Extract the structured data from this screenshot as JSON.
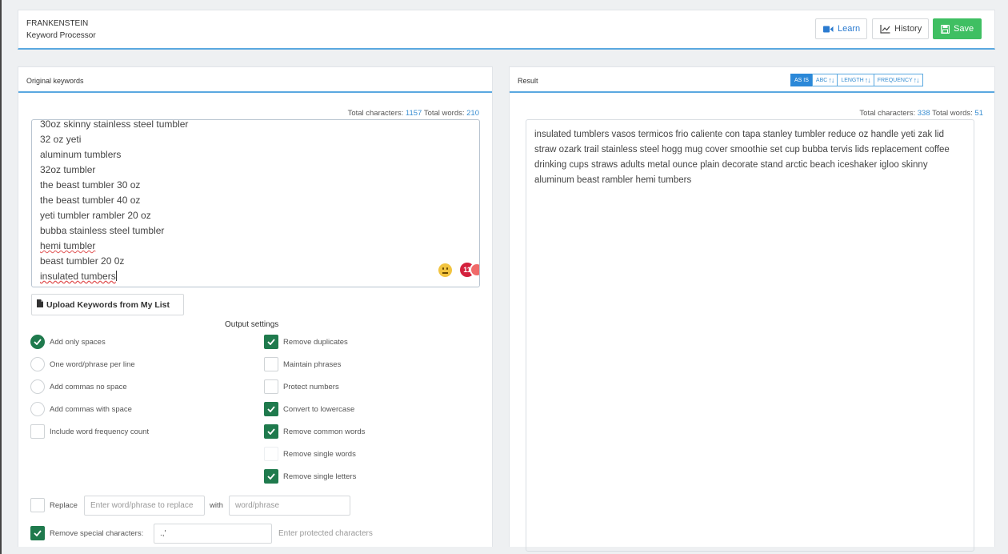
{
  "app": {
    "title": "FRANKENSTEIN",
    "subtitle": "Keyword Processor"
  },
  "toolbar": {
    "learn_label": "Learn",
    "history_label": "History",
    "save_label": "Save"
  },
  "left_panel": {
    "title": "Original keywords",
    "stats": {
      "chars_label": "Total characters:",
      "chars": "1157",
      "words_label": "Total words:",
      "words": "210"
    },
    "keywords": [
      "30oz skinny stainless steel tumbler",
      "32 oz yeti",
      "aluminum tumblers",
      "32oz tumbler",
      "the beast tumbler 30 oz",
      "the beast tumbler 40 oz",
      "yeti tumbler rambler 20 oz",
      "bubba stainless steel tumbler",
      "hemi tumbler",
      "beast tumbler 20 0z",
      "insulated tumbers"
    ],
    "grammar_count": "11",
    "upload_label": "Upload Keywords from My List",
    "output_settings_title": "Output settings",
    "radios": [
      {
        "label": "Add only spaces",
        "checked": true
      },
      {
        "label": "One word/phrase per line",
        "checked": false
      },
      {
        "label": "Add commas no space",
        "checked": false
      },
      {
        "label": "Add commas with space",
        "checked": false
      }
    ],
    "include_freq": {
      "label": "Include word frequency count",
      "checked": false
    },
    "checks": [
      {
        "label": "Remove duplicates",
        "checked": true
      },
      {
        "label": "Maintain phrases",
        "checked": false
      },
      {
        "label": "Protect numbers",
        "checked": false
      },
      {
        "label": "Convert to lowercase",
        "checked": true
      },
      {
        "label": "Remove common words",
        "checked": true
      },
      {
        "label": "Remove single words",
        "checked": false
      },
      {
        "label": "Remove single letters",
        "checked": true
      }
    ],
    "replace": {
      "label": "Replace",
      "checked": false,
      "find_placeholder": "Enter word/phrase to replace",
      "with_label": "with",
      "with_placeholder": "word/phrase"
    },
    "special": {
      "label": "Remove special characters:",
      "checked": true,
      "value": ".,'",
      "protected_placeholder": "Enter protected characters"
    }
  },
  "right_panel": {
    "title": "Result",
    "sort_buttons": [
      {
        "label": "AS IS",
        "arrows": "",
        "active": true
      },
      {
        "label": "ABC",
        "arrows": "↑↓",
        "active": false
      },
      {
        "label": "LENGTH",
        "arrows": "↑↓",
        "active": false
      },
      {
        "label": "FREQUENCY",
        "arrows": "↑↓",
        "active": false
      }
    ],
    "stats": {
      "chars_label": "Total characters:",
      "chars": "338",
      "words_label": "Total words:",
      "words": "51"
    },
    "result_text": "insulated tumblers vasos termicos frio caliente con tapa stanley tumbler reduce oz handle yeti zak lid straw ozark trail stainless steel hogg mug cover smoothie set cup bubba tervis lids replacement coffee drinking cups straws adults metal ounce plain decorate stand arctic beach iceshaker igloo skinny aluminum beast rambler hemi tumbers"
  }
}
